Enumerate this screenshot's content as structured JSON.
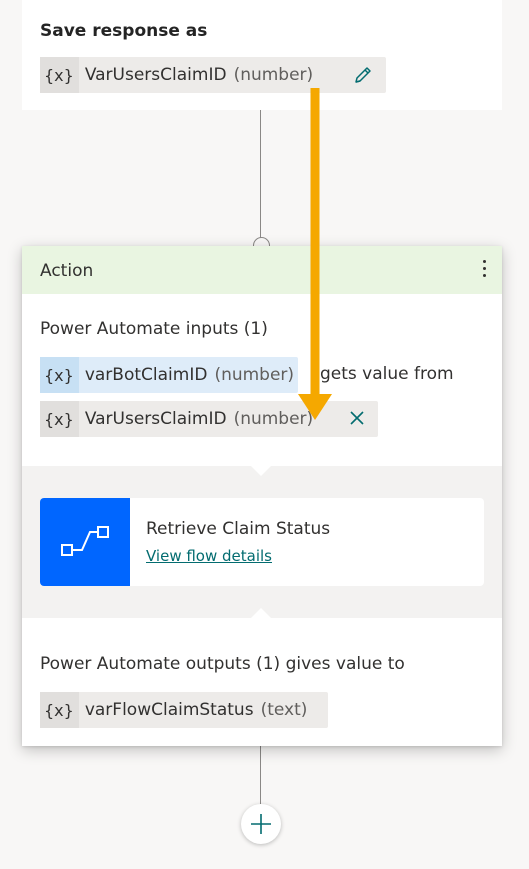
{
  "save_response": {
    "title": "Save response as",
    "var_icon": "{x}",
    "var_name": "VarUsersClaimID",
    "var_type": "(number)",
    "edit_icon": "pencil-icon"
  },
  "action": {
    "title": "Action",
    "menu_icon": "more-vertical-icon",
    "inputs_label": "Power Automate inputs (1)",
    "input_param": {
      "var_icon": "{x}",
      "name": "varBotClaimID",
      "type": "(number)"
    },
    "gets_value_text": "gets value from",
    "input_source": {
      "var_icon": "{x}",
      "name": "VarUsersClaimID",
      "type": "(number)",
      "remove_icon": "close-icon"
    },
    "flow": {
      "name": "Retrieve Claim Status",
      "link_text": "View flow details",
      "icon": "flow-icon",
      "icon_color": "#0066ff"
    },
    "outputs_label": "Power Automate outputs (1) gives value to",
    "output_var": {
      "var_icon": "{x}",
      "name": "varFlowClaimStatus",
      "type": "(text)"
    }
  },
  "add_node_icon": "plus-icon",
  "annotation": {
    "arrow_color": "#f5a800"
  },
  "colors": {
    "header_bg": "#e9f5e1",
    "accent": "#036c70"
  }
}
